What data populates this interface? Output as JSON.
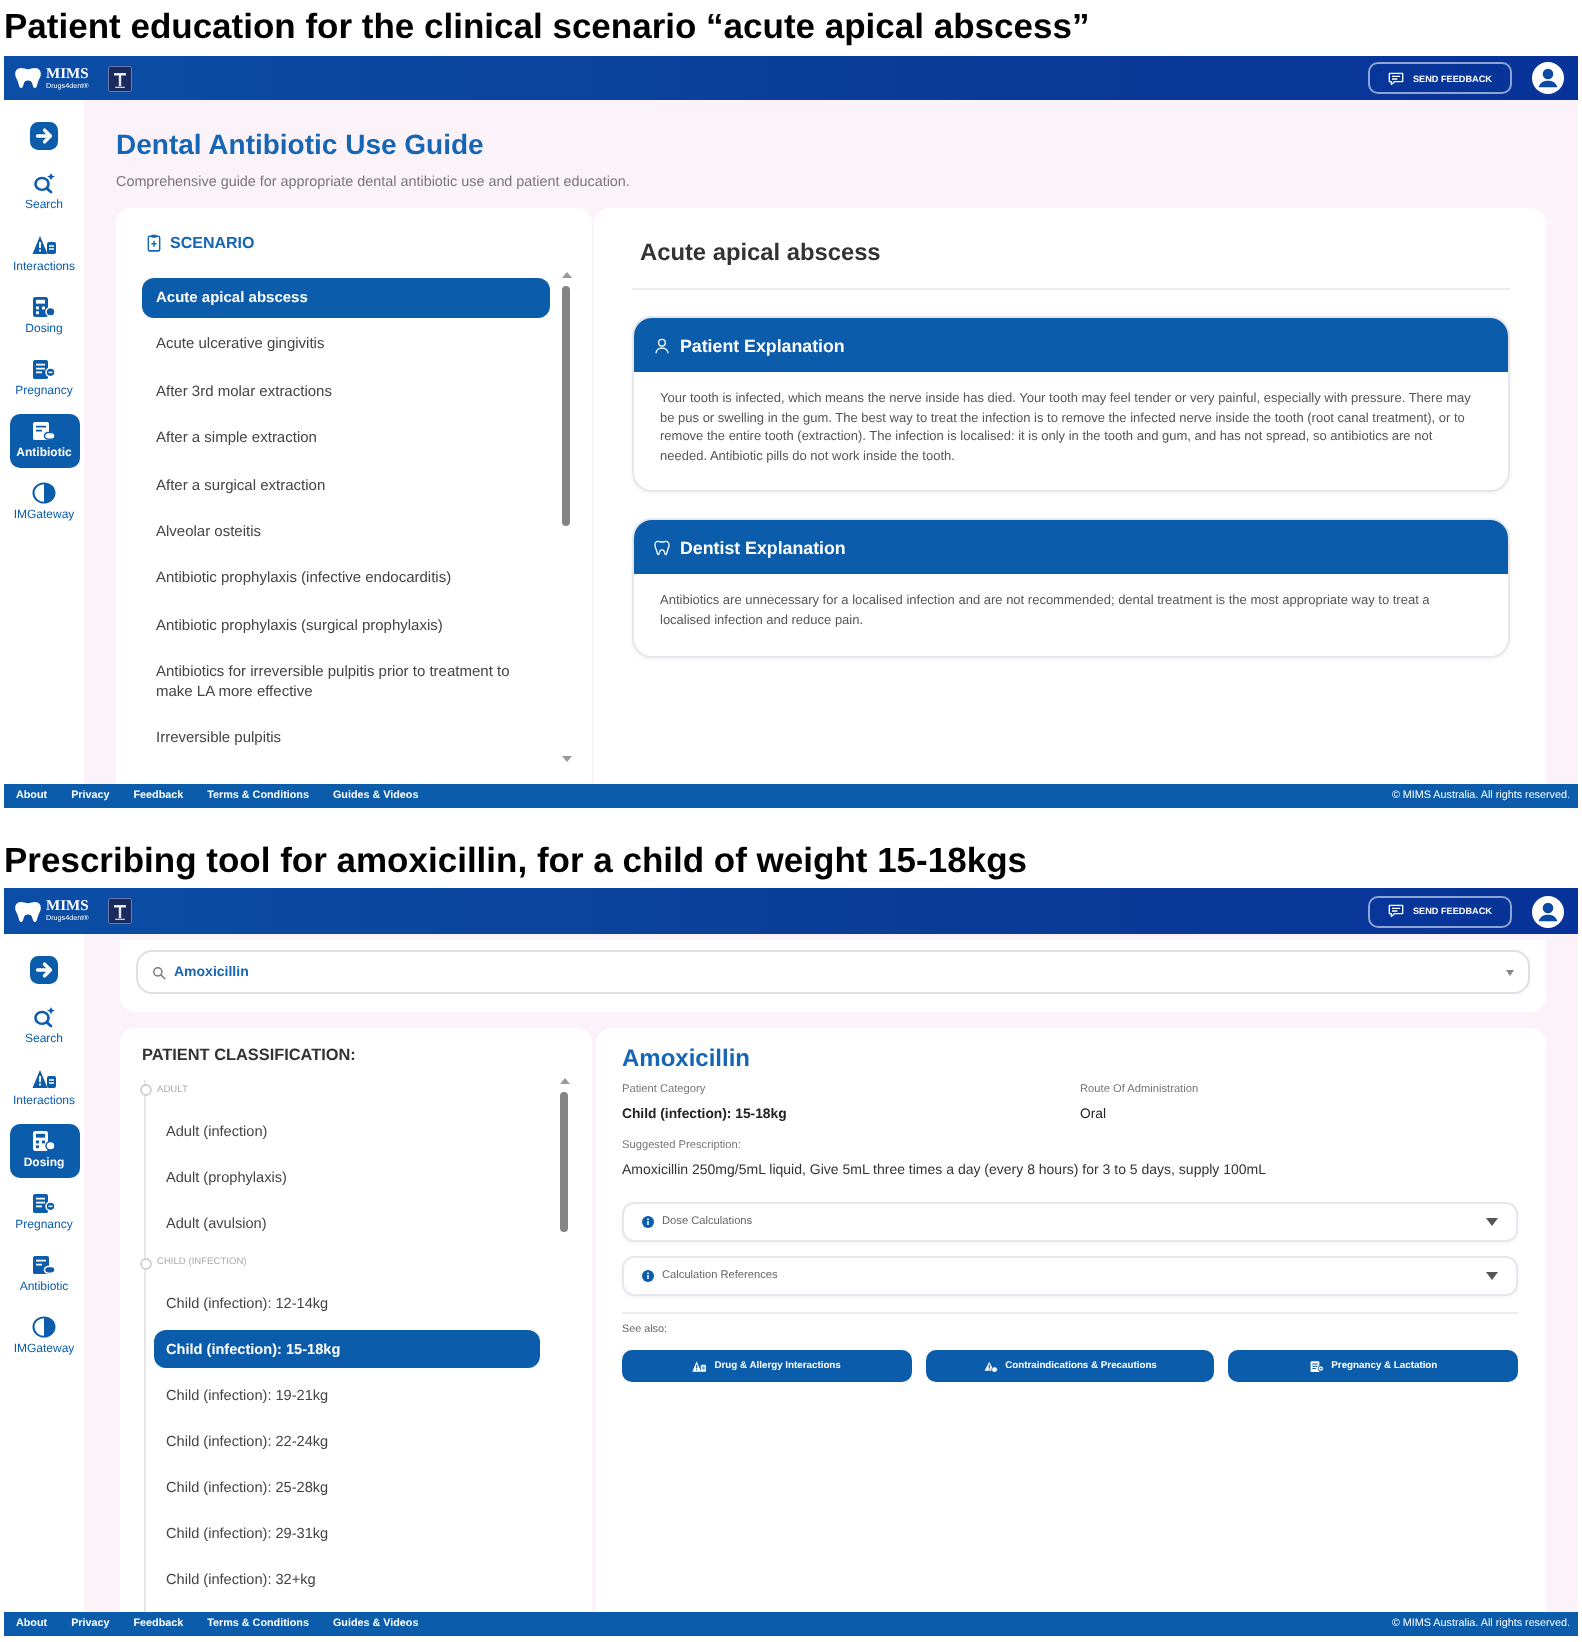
{
  "panels": [
    {
      "kind": "guide",
      "caption": "Patient education for the clinical scenario “acute apical abscess”",
      "header": {
        "brand": "MIMS",
        "brand_subtitle": "Drugs4dent®",
        "feedback_button": "SEND FEEDBACK"
      },
      "sidebar": {
        "items": [
          {
            "label": "Search",
            "selected": false
          },
          {
            "label": "Interactions",
            "selected": false
          },
          {
            "label": "Dosing",
            "selected": false
          },
          {
            "label": "Pregnancy",
            "selected": false
          },
          {
            "label": "Antibiotic",
            "selected": true
          },
          {
            "label": "IMGateway",
            "selected": false
          }
        ]
      },
      "page": {
        "title": "Dental Antibiotic Use Guide",
        "subtitle": "Comprehensive guide for appropriate dental antibiotic use and patient education."
      },
      "scenario": {
        "heading": "SCENARIO",
        "items": [
          {
            "label": "Acute apical abscess",
            "selected": true
          },
          {
            "label": "Acute ulcerative gingivitis",
            "selected": false
          },
          {
            "label": "After 3rd molar extractions",
            "selected": false
          },
          {
            "label": "After a simple extraction",
            "selected": false
          },
          {
            "label": "After a surgical extraction",
            "selected": false
          },
          {
            "label": "Alveolar osteitis",
            "selected": false
          },
          {
            "label": "Antibiotic prophylaxis (infective endocarditis)",
            "selected": false
          },
          {
            "label": "Antibiotic prophylaxis (surgical prophylaxis)",
            "selected": false
          },
          {
            "label": "Antibiotics for irreversible pulpitis prior to treatment to make LA more effective",
            "selected": false
          },
          {
            "label": "Irreversible pulpitis",
            "selected": false
          }
        ]
      },
      "detail": {
        "title": "Acute apical abscess",
        "sections": [
          {
            "heading": "Patient Explanation",
            "body": "Your tooth is infected, which means the nerve inside has died. Your tooth may feel tender or very painful, especially with pressure. There may be pus or swelling in the gum. The best way to treat the infection is to remove the infected nerve inside the tooth (root canal treatment), or to remove the entire tooth (extraction). The infection is localised: it is only in the tooth and gum, and has not spread, so antibiotics are not needed. Antibiotic pills do not work inside the tooth."
          },
          {
            "heading": "Dentist Explanation",
            "body": "Antibiotics are unnecessary for a localised infection and are not recommended; dental treatment is the most appropriate way to treat a localised infection and reduce pain."
          }
        ]
      },
      "footer": {
        "links": [
          "About",
          "Privacy",
          "Feedback",
          "Terms & Conditions",
          "Guides & Videos"
        ],
        "copyright": "© MIMS Australia. All rights reserved."
      }
    },
    {
      "kind": "dosing",
      "caption": "Prescribing tool for amoxicillin, for a child of weight 15-18kgs",
      "header": {
        "brand": "MIMS",
        "brand_subtitle": "Drugs4dent®",
        "feedback_button": "SEND FEEDBACK"
      },
      "sidebar": {
        "items": [
          {
            "label": "Search",
            "selected": false
          },
          {
            "label": "Interactions",
            "selected": false
          },
          {
            "label": "Dosing",
            "selected": true
          },
          {
            "label": "Pregnancy",
            "selected": false
          },
          {
            "label": "Antibiotic",
            "selected": false
          },
          {
            "label": "IMGateway",
            "selected": false
          }
        ]
      },
      "search": {
        "value": "Amoxicillin"
      },
      "classification": {
        "heading": "PATIENT CLASSIFICATION:",
        "groups": [
          {
            "label": "ADULT",
            "children": [
              {
                "label": "Adult (infection)",
                "selected": false
              },
              {
                "label": "Adult (prophylaxis)",
                "selected": false
              },
              {
                "label": "Adult (avulsion)",
                "selected": false
              }
            ]
          },
          {
            "label": "CHILD (INFECTION)",
            "children": [
              {
                "label": "Child (infection): 12-14kg",
                "selected": false
              },
              {
                "label": "Child (infection): 15-18kg",
                "selected": true
              },
              {
                "label": "Child (infection): 19-21kg",
                "selected": false
              },
              {
                "label": "Child (infection): 22-24kg",
                "selected": false
              },
              {
                "label": "Child (infection): 25-28kg",
                "selected": false
              },
              {
                "label": "Child (infection): 29-31kg",
                "selected": false
              },
              {
                "label": "Child (infection): 32+kg",
                "selected": false
              }
            ]
          }
        ]
      },
      "detail": {
        "title": "Amoxicillin",
        "fields": [
          {
            "label": "Patient Category",
            "value": "Child (infection): 15-18kg"
          },
          {
            "label": "Route Of Administration",
            "value": "Oral"
          }
        ],
        "prescription": {
          "label": "Suggested Prescription:",
          "value": "Amoxicillin 250mg/5mL liquid, Give 5mL three times a day (every 8 hours) for 3 to 5 days, supply 100mL"
        },
        "accordions": [
          {
            "label": "Dose Calculations",
            "expanded": false
          },
          {
            "label": "Calculation References",
            "expanded": false
          }
        ],
        "see_also": {
          "label": "See also:",
          "buttons": [
            "Drug & Allergy Interactions",
            "Contraindications & Precautions",
            "Pregnancy & Lactation"
          ]
        }
      },
      "footer": {
        "links": [
          "About",
          "Privacy",
          "Feedback",
          "Terms & Conditions",
          "Guides & Videos"
        ],
        "copyright": "© MIMS Australia. All rights reserved."
      }
    }
  ]
}
